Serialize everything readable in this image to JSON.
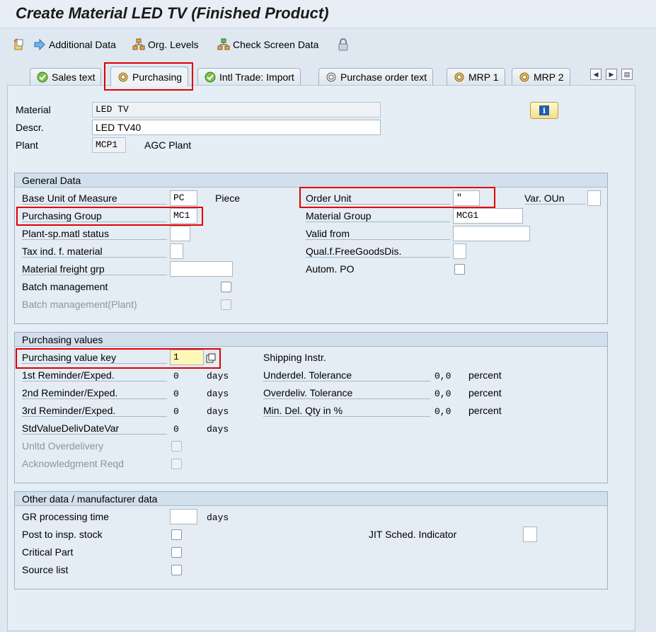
{
  "window": {
    "title": "Create Material LED TV (Finished Product)"
  },
  "toolbar": {
    "additional_data": "Additional Data",
    "org_levels": "Org. Levels",
    "check_screen_data": "Check Screen Data"
  },
  "tabs": [
    {
      "label": "Sales text",
      "icon": "checkmark-icon"
    },
    {
      "label": "Purchasing",
      "icon": "gear-icon",
      "active": true
    },
    {
      "label": "Intl Trade: Import",
      "icon": "checkmark-icon"
    },
    {
      "label": "Purchase order text",
      "icon": "gear-icon"
    },
    {
      "label": "MRP 1",
      "icon": "gear-icon"
    },
    {
      "label": "MRP 2",
      "icon": "gear-icon"
    }
  ],
  "header": {
    "material_label": "Material",
    "material_value": "LED TV",
    "descr_label": "Descr.",
    "descr_value": "LED TV40",
    "plant_label": "Plant",
    "plant_value": "MCP1",
    "plant_name": "AGC Plant"
  },
  "general_data": {
    "title": "General Data",
    "base_uom_label": "Base Unit of Measure",
    "base_uom_value": "PC",
    "base_uom_text": "Piece",
    "order_unit_label": "Order Unit",
    "order_unit_value": "\"",
    "var_oun_label": "Var. OUn",
    "purchasing_group_label": "Purchasing Group",
    "purchasing_group_value": "MC1",
    "material_group_label": "Material Group",
    "material_group_value": "MCG1",
    "plant_sp_status_label": "Plant-sp.matl status",
    "valid_from_label": "Valid from",
    "tax_ind_label": "Tax ind. f. material",
    "qual_free_goods_label": "Qual.f.FreeGoodsDis.",
    "freight_grp_label": "Material freight grp",
    "autom_po_label": "Autom. PO",
    "batch_mgmt_label": "Batch management",
    "batch_mgmt_plant_label": "Batch management(Plant)"
  },
  "purchasing_values": {
    "title": "Purchasing values",
    "value_key_label": "Purchasing value key",
    "value_key_value": "1",
    "shipping_instr_label": "Shipping Instr.",
    "reminder1_label": "1st Reminder/Exped.",
    "reminder1_value": "0",
    "reminder2_label": "2nd Reminder/Exped.",
    "reminder2_value": "0",
    "reminder3_label": "3rd Reminder/Exped.",
    "reminder3_value": "0",
    "std_value_label": "StdValueDelivDateVar",
    "std_value_value": "0",
    "days_unit": "days",
    "underdel_label": "Underdel. Tolerance",
    "underdel_value": "0,0",
    "overdeliv_label": "Overdeliv. Tolerance",
    "overdeliv_value": "0,0",
    "min_del_label": "Min. Del. Qty in %",
    "min_del_value": "0,0",
    "percent_unit": "percent",
    "unltd_label": "Unltd Overdelivery",
    "ack_label": "Acknowledgment Reqd"
  },
  "other_data": {
    "title": "Other data / manufacturer data",
    "gr_time_label": "GR processing time",
    "days_unit": "days",
    "post_insp_label": "Post to insp. stock",
    "jit_label": "JIT Sched. Indicator",
    "critical_part_label": "Critical Part",
    "source_list_label": "Source list"
  },
  "colors": {
    "highlight": "#e00000",
    "background": "#dfe8f1",
    "group_header": "#d2dfec"
  }
}
